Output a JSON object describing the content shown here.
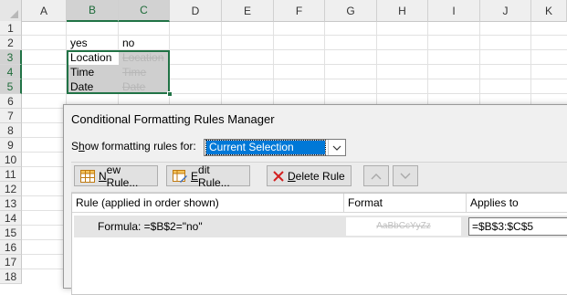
{
  "sheet": {
    "columns": [
      "A",
      "B",
      "C",
      "D",
      "E",
      "F",
      "G",
      "H",
      "I",
      "J",
      "K"
    ],
    "selected_columns": [
      "B",
      "C"
    ],
    "rows": [
      "1",
      "2",
      "3",
      "4",
      "5",
      "6",
      "7",
      "8",
      "9",
      "10",
      "11",
      "12",
      "13",
      "14",
      "15",
      "16",
      "17",
      "18"
    ],
    "selected_rows": [
      "3",
      "4",
      "5"
    ],
    "cells": {
      "B2": "yes",
      "C2": "no",
      "B3": "Location",
      "C3": "Location",
      "B4": "Time",
      "C4": "Time",
      "B5": "Date",
      "C5": "Date"
    },
    "accent_color": "#217346"
  },
  "dialog": {
    "title": "Conditional Formatting Rules Manager",
    "show_rules_label_prefix": "S",
    "show_rules_label_mnemonic": "h",
    "show_rules_label_rest": "ow formatting rules for:",
    "show_rules_value": "Current Selection",
    "toolbar": {
      "new_rule_mnemonic": "N",
      "new_rule_rest": "ew Rule...",
      "edit_rule_mnemonic": "E",
      "edit_rule_rest": "dit Rule...",
      "delete_rule_mnemonic": "D",
      "delete_rule_rest": "elete Rule"
    },
    "table": {
      "headers": {
        "rule": "Rule (applied in order shown)",
        "format": "Format",
        "applies_to": "Applies to"
      },
      "rows": [
        {
          "rule": "Formula: =$B$2=\"no\"",
          "format_preview": "AaBbCcYyZz",
          "applies_to": "=$B$3:$C$5"
        }
      ]
    },
    "selection_color": "#0078d7"
  }
}
